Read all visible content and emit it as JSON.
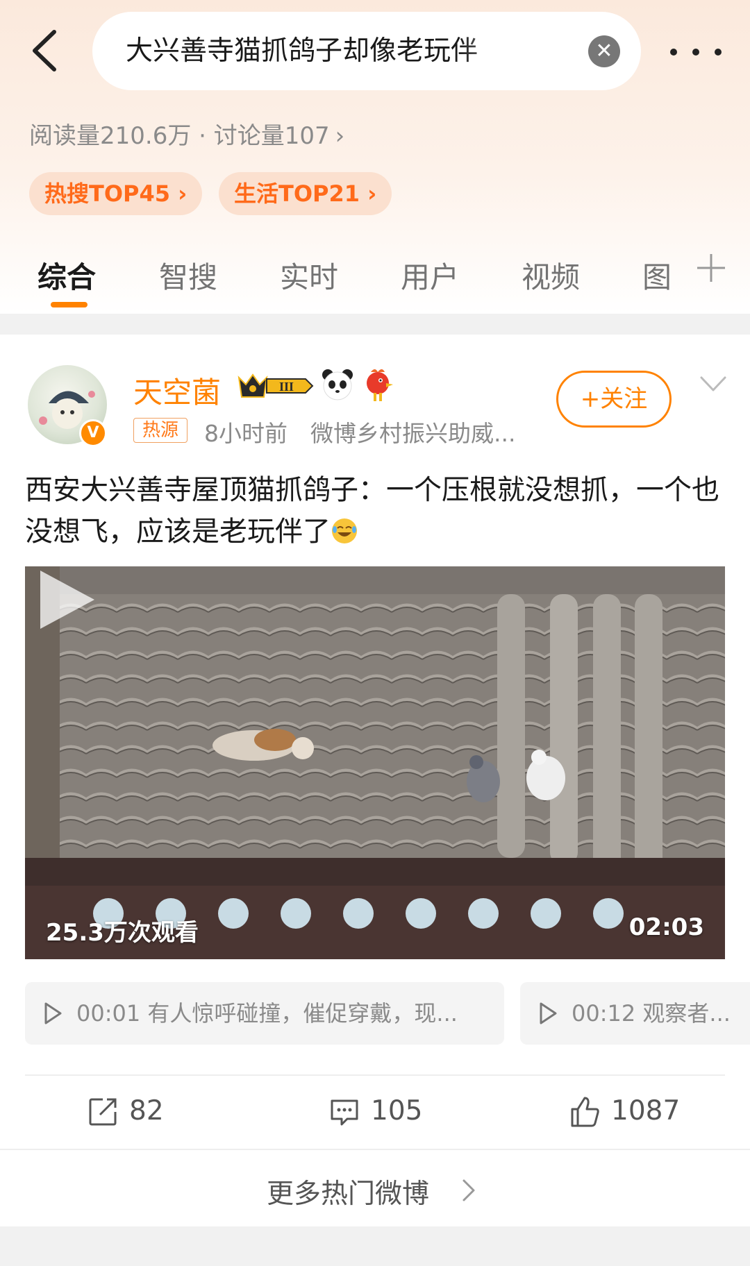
{
  "header": {
    "search_query": "大兴善寺猫抓鸽子却像老玩伴",
    "stats": "阅读量210.6万 · 讨论量107",
    "badges": [
      "热搜TOP45",
      "生活TOP21"
    ]
  },
  "tabs": [
    {
      "label": "综合",
      "active": true
    },
    {
      "label": "智搜",
      "active": false
    },
    {
      "label": "实时",
      "active": false
    },
    {
      "label": "用户",
      "active": false
    },
    {
      "label": "视频",
      "active": false
    },
    {
      "label": "图",
      "active": false
    }
  ],
  "post": {
    "author": "天空菌",
    "level_mark": "III",
    "source_badge": "热源",
    "meta": "8小时前　微博乡村振兴助威...",
    "follow_label": "+关注",
    "text": "西安大兴善寺屋顶猫抓鸽子：一个压根就没想抓，一个也没想飞，应该是老玩伴了",
    "video": {
      "views": "25.3万次观看",
      "duration": "02:03"
    },
    "chapters": [
      {
        "time": "00:01",
        "text": "有人惊呼碰撞，催促穿戴，现..."
      },
      {
        "time": "00:12",
        "text": "观察者..."
      }
    ],
    "actions": {
      "repost": "82",
      "comment": "105",
      "like": "1087"
    }
  },
  "more_label": "更多热门微博",
  "colors": {
    "accent": "#ff8200",
    "badge_bg": "#fbe0cf",
    "header_bg": "#fbe9dc"
  },
  "icons": [
    "back-arrow-icon",
    "clear-icon",
    "more-dots-icon",
    "chevron-right-icon",
    "add-tab-icon",
    "verified-icon",
    "level-crown-icon",
    "panda-emoji-icon",
    "rooster-emoji-icon",
    "collapse-chevron-icon",
    "laugh-emoji-icon",
    "play-icon",
    "repost-icon",
    "comment-icon",
    "like-icon"
  ]
}
